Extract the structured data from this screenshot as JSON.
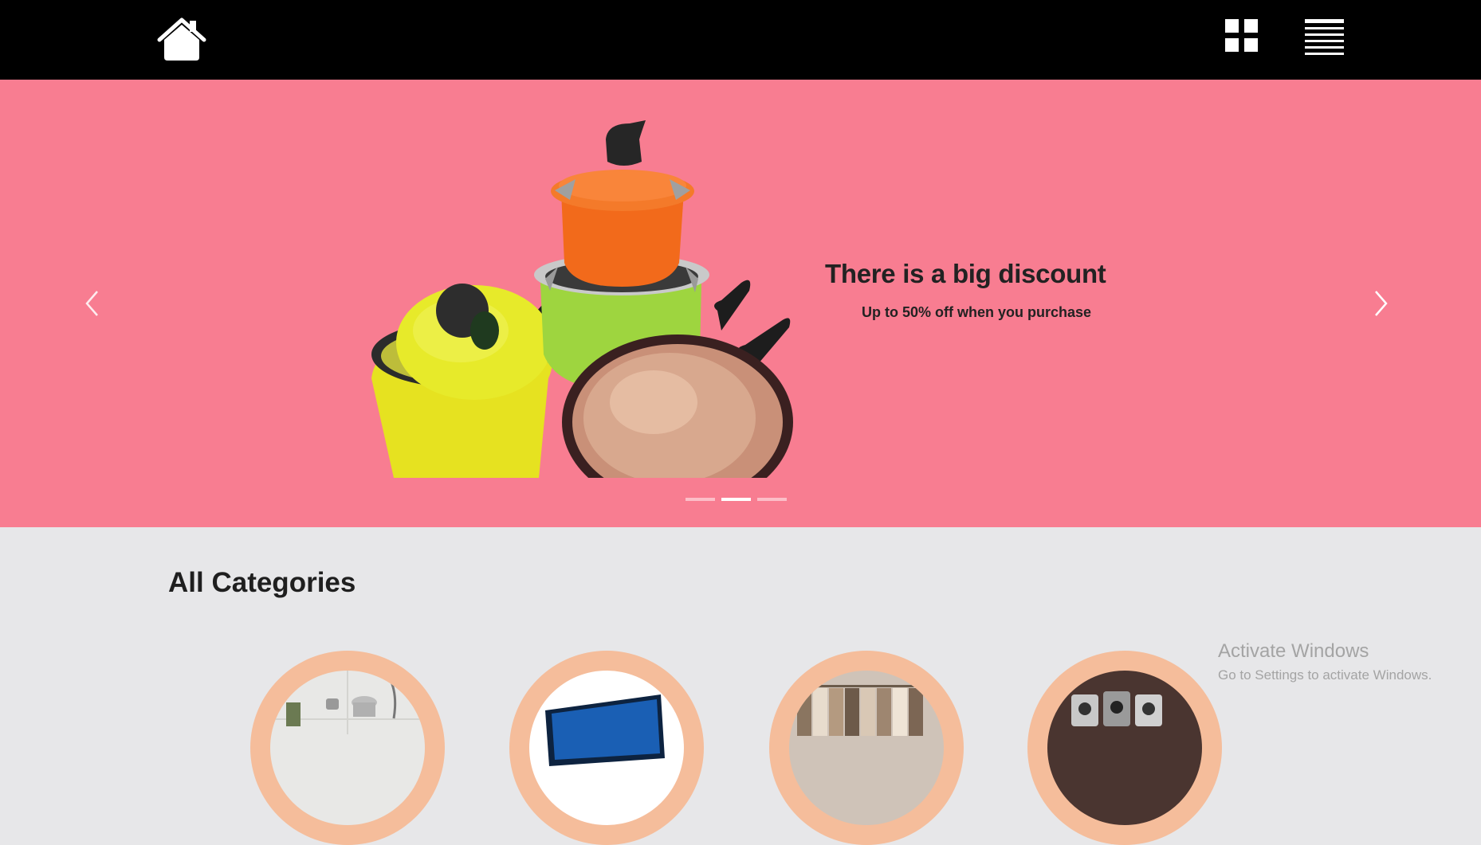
{
  "navbar": {
    "home_icon": "home-icon",
    "grid_icon": "grid-view-icon",
    "list_icon": "list-view-icon",
    "background": "#000000"
  },
  "hero": {
    "background": "#f87d91",
    "title": "There is a big discount",
    "subtitle": "Up to 50% off when you purchase",
    "prev_icon": "chevron-left-icon",
    "next_icon": "chevron-right-icon",
    "active_slide": 2,
    "slide_count": 3
  },
  "categories": {
    "title": "All Categories",
    "ring_color": "#f5bd9b",
    "items": [
      {
        "icon": "kitchenware-image"
      },
      {
        "icon": "electronics-image"
      },
      {
        "icon": "clothing-image"
      },
      {
        "icon": "appliances-image"
      }
    ]
  },
  "watermark": {
    "title": "Activate Windows",
    "subtitle": "Go to Settings to activate Windows."
  }
}
